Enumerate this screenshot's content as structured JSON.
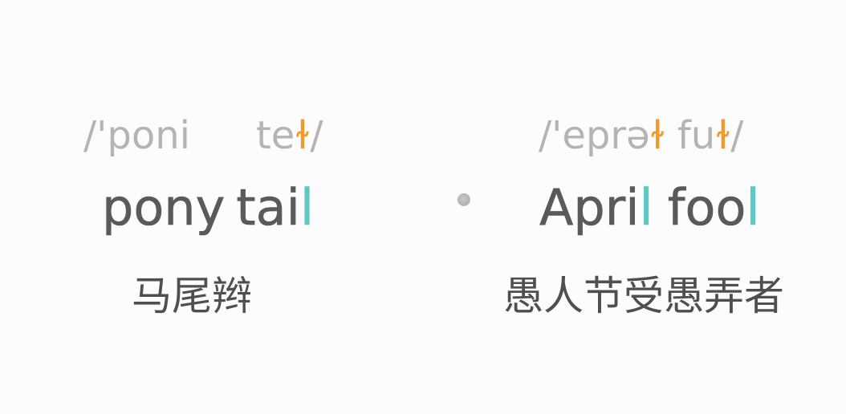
{
  "colors": {
    "background": "#fdfcfd",
    "ipa_gray": "#b4b4b4",
    "word_dark": "#5a5a5a",
    "meaning_dark": "#4f4f4f",
    "orange_highlight": "#f2992e",
    "teal_highlight": "#5dc9c2"
  },
  "left": {
    "ipa_part1": "/'poni",
    "ipa_part2_a": "te",
    "ipa_part2_highlight": "ɫ",
    "ipa_part2_end": "/",
    "word1": "pony",
    "word2_a": "tai",
    "word2_highlight": "l",
    "meaning": "马尾辫"
  },
  "right": {
    "ipa_a": "/'eprə",
    "ipa_h1": "ɫ",
    "ipa_b": " fu",
    "ipa_h2": "ɫ",
    "ipa_end": "/",
    "word1_a": "Apri",
    "word1_highlight": "l",
    "word2_a": "foo",
    "word2_highlight": "l",
    "meaning": "愚人节受愚弄者"
  }
}
